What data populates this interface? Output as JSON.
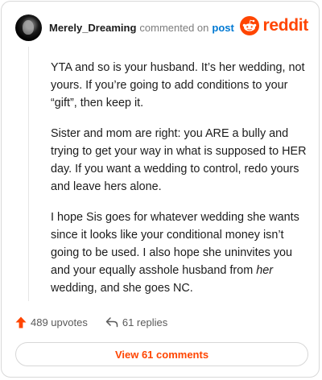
{
  "header": {
    "username": "Merely_Dreaming",
    "commented_text": "commented on",
    "post_link": "post",
    "brand": "reddit"
  },
  "comment": {
    "para1": "YTA and so is your husband. It’s her wedding, not yours. If you’re going to add conditions to your “gift”, then keep it.",
    "para2": "Sister and mom are right: you ARE a bully and trying to get your way in what is supposed to HER day. If you want a wedding to control, redo yours and leave hers alone.",
    "para3_before_em": "I hope Sis goes for whatever wedding she wants since it looks like your conditional money isn’t going to be used. I also hope she uninvites you and your equally asshole husband from ",
    "para3_em": "her",
    "para3_after_em": " wedding, and she goes NC."
  },
  "actions": {
    "upvotes": "489 upvotes",
    "replies": "61 replies"
  },
  "view_comments_label": "View 61 comments",
  "colors": {
    "brand": "#ff4500",
    "link": "#0079d3"
  }
}
